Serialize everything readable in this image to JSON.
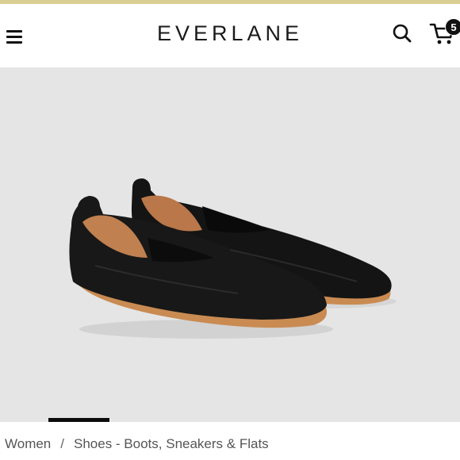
{
  "colors": {
    "top_accent": "#d9cf94",
    "hero_background": "#e5e5e5",
    "text_primary": "#1a1a1a",
    "text_secondary": "#555555"
  },
  "header": {
    "logo_text": "EVERLANE",
    "menu_icon": "hamburger-icon",
    "search_icon": "search-icon",
    "cart_icon": "cart-icon",
    "cart_count": "5"
  },
  "hero": {
    "image_description_icon": "shoes-image"
  },
  "carousel": {
    "active_index": 1
  },
  "breadcrumb": {
    "items": [
      "Women",
      "Shoes - Boots, Sneakers & Flats"
    ],
    "separator": "/"
  }
}
